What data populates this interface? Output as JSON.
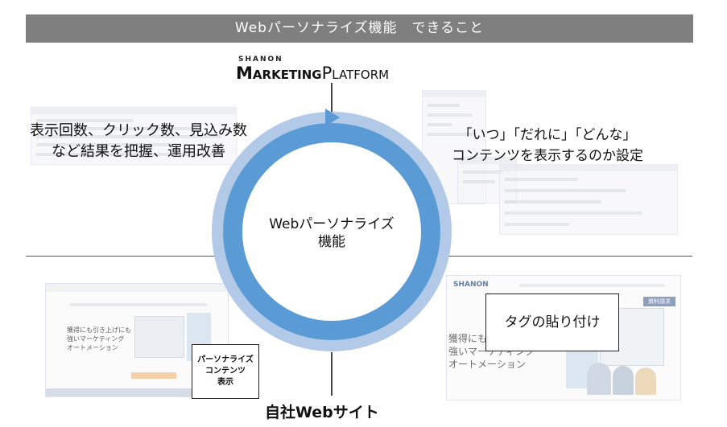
{
  "header": {
    "title": "Webパーソナライズ機能　できること"
  },
  "logo": {
    "top": "SHANON",
    "main_a": "M",
    "main_b": "ARKETING",
    "main_c": "P",
    "main_d": "LATFORM"
  },
  "center": {
    "line1": "Webパーソナライズ",
    "line2": "機能"
  },
  "left_text": {
    "line1": "表示回数、クリック数、見込み数",
    "line2": "など結果を把握、運用改善"
  },
  "right_text": {
    "line1": "「いつ」「だれに」「どんな」",
    "line2": "コンテンツを表示するのか設定"
  },
  "bottom_left_box": {
    "line1": "パーソナライズ",
    "line2": "コンテンツ",
    "line3": "表示"
  },
  "bottom_right_box": {
    "label": "タグの貼り付け"
  },
  "site_left": {
    "headline1": "獲得にも引き上げにも",
    "headline2": "強いマーケティング",
    "headline3": "オートメーション"
  },
  "site_right": {
    "logo": "SHANON",
    "headline1": "獲得にも",
    "headline2": "強いマーケティング",
    "headline3": "オートメーション",
    "button": "資料請求"
  },
  "footer": {
    "label": "自社Webサイト"
  },
  "colors": {
    "ring_outer": "#b3c9e8",
    "ring_inner": "#5b9bd5",
    "title_bar": "#7f7f7f"
  }
}
